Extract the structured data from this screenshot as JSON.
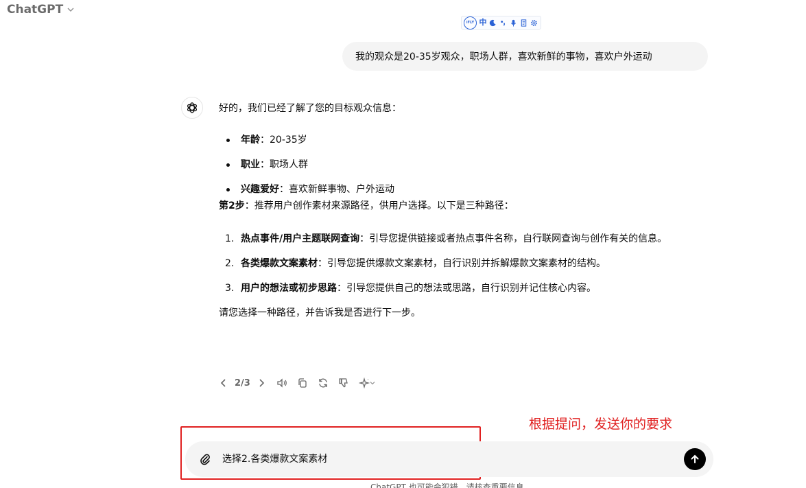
{
  "header": {
    "model_name": "ChatGPT"
  },
  "ifly_toolbar": {
    "logo_text": "iFLY",
    "lang_label": "中"
  },
  "user_message": {
    "text": "我的观众是20-35岁观众，职场人群，喜欢新鲜的事物，喜欢户外运动"
  },
  "assistant_message": {
    "intro": "好的，我们已经了解了您的目标观众信息：",
    "audience_items": [
      {
        "label": "年龄",
        "sep": "：",
        "value": "20-35岁"
      },
      {
        "label": "职业",
        "sep": "：",
        "value": "职场人群"
      },
      {
        "label": "兴趣爱好",
        "sep": "：",
        "value": "喜欢新鲜事物、户外运动"
      }
    ],
    "step_label": "第2步",
    "step_text": "：推荐用户创作素材来源路径，供用户选择。以下是三种路径：",
    "paths": [
      {
        "num": "1.",
        "label": "热点事件/用户主题联网查询",
        "text": "：引导您提供链接或者热点事件名称，自行联网查询与创作有关的信息。"
      },
      {
        "num": "2.",
        "label": "各类爆款文案素材",
        "text": "：引导您提供爆款文案素材，自行识别并拆解爆款文案素材的结构。"
      },
      {
        "num": "3.",
        "label": "用户的想法或初步思路",
        "text": "：引导您提供自己的想法或思路，自行识别并记住核心内容。"
      }
    ],
    "closing": "请您选择一种路径，并告诉我是否进行下一步。"
  },
  "response_actions": {
    "pager": "2/3"
  },
  "annotation": {
    "text": "根据提问，发送你的要求"
  },
  "composer": {
    "value": "选择2.各类爆款文案素材"
  },
  "footer": {
    "disclaimer": "ChatGPT 也可能会犯错。请核查重要信息。"
  },
  "colors": {
    "annotation_red": "#e02020",
    "bubble_bg": "#f4f4f4",
    "send_bg": "#000000",
    "ifly_blue": "#2a62d6"
  }
}
